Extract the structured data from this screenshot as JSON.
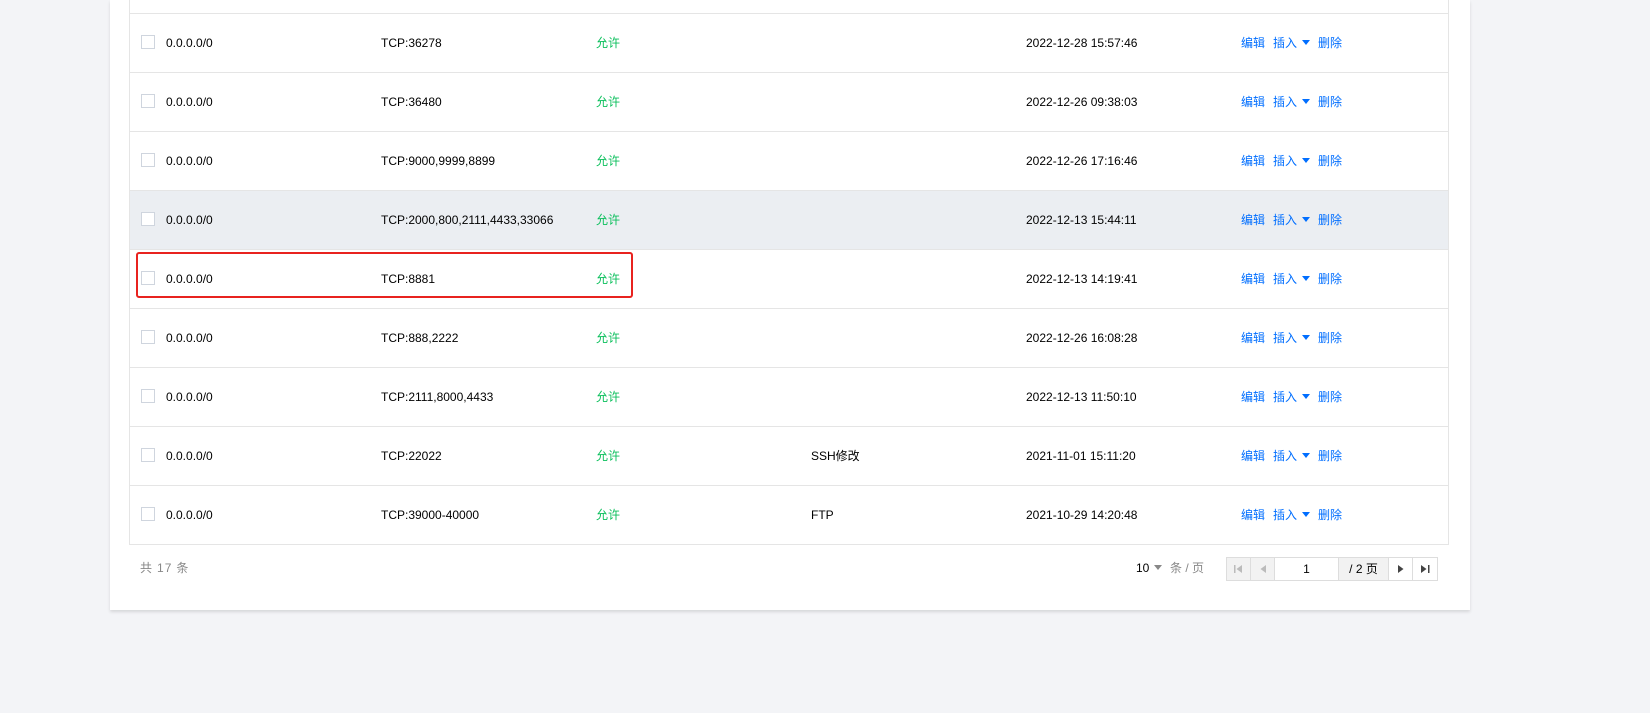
{
  "table": {
    "rows": [
      {
        "source": "0.0.0.0/0",
        "port": "TCP:36278",
        "policy": "允许",
        "remark": "",
        "time": "2022-12-28 15:57:46"
      },
      {
        "source": "0.0.0.0/0",
        "port": "TCP:36480",
        "policy": "允许",
        "remark": "",
        "time": "2022-12-26 09:38:03"
      },
      {
        "source": "0.0.0.0/0",
        "port": "TCP:9000,9999,8899",
        "policy": "允许",
        "remark": "",
        "time": "2022-12-26 17:16:46"
      },
      {
        "source": "0.0.0.0/0",
        "port": "TCP:2000,800,2111,4433,33066",
        "policy": "允许",
        "remark": "",
        "time": "2022-12-13 15:44:11"
      },
      {
        "source": "0.0.0.0/0",
        "port": "TCP:8881",
        "policy": "允许",
        "remark": "",
        "time": "2022-12-13 14:19:41"
      },
      {
        "source": "0.0.0.0/0",
        "port": "TCP:888,2222",
        "policy": "允许",
        "remark": "",
        "time": "2022-12-26 16:08:28"
      },
      {
        "source": "0.0.0.0/0",
        "port": "TCP:2111,8000,4433",
        "policy": "允许",
        "remark": "",
        "time": "2022-12-13 11:50:10"
      },
      {
        "source": "0.0.0.0/0",
        "port": "TCP:22022",
        "policy": "允许",
        "remark": "SSH修改",
        "time": "2021-11-01 15:11:20"
      },
      {
        "source": "0.0.0.0/0",
        "port": "TCP:39000-40000",
        "policy": "允许",
        "remark": "FTP",
        "time": "2021-10-29 14:20:48"
      }
    ],
    "ops": {
      "edit": "编辑",
      "insert": "插入",
      "delete": "删除"
    }
  },
  "footer": {
    "total_prefix": "共",
    "total_count": "17",
    "total_suffix": "条",
    "page_size": "10",
    "per_page_label": "条 / 页",
    "current_page": "1",
    "total_pages": "/ 2 页"
  },
  "colors": {
    "allow": "#0abf5b",
    "link": "#006eff",
    "highlight_border": "#e8231f",
    "hover_row": "#ebeef2"
  }
}
